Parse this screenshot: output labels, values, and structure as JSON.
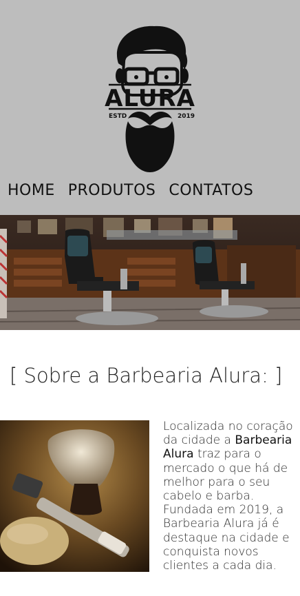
{
  "logo": {
    "brand": "ALURA",
    "estd_label": "ESTD",
    "year": "2019",
    "icon": "bearded-man-logo"
  },
  "nav": {
    "home": "HOME",
    "produtos": "PRODUTOS",
    "contatos": "CONTATOS"
  },
  "banner": {
    "icon": "barbershop-interior-photo"
  },
  "about": {
    "title": "[ Sobre a Barbearia Alura: ]",
    "text_before": "Localizada no coração da cidade a ",
    "highlight": "Barbearia Alura",
    "text_after": " traz para o mercado o que há de melhor para o seu cabelo e barba. Fundada em 2019, a Barbearia Alura já é destaque na cidade e conquista novos clientes a cada dia.",
    "image_icon": "shaving-brush-razor-photo"
  },
  "colors": {
    "header_bg": "#bdbdbd",
    "text": "#1a1a1a"
  }
}
